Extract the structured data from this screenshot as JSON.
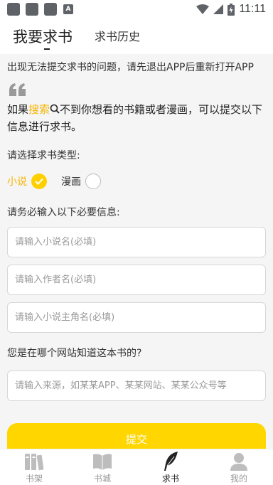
{
  "status_bar": {
    "time": "11:11",
    "icons": [
      "notification-square-icon",
      "notification-square-icon",
      "notification-square-icon",
      "a-icon",
      "wifi-icon",
      "signal-icon",
      "battery-icon"
    ]
  },
  "header": {
    "active_tab": "我要求书",
    "second_tab": "求书历史"
  },
  "notice": "出现无法提交求书的问题，请先退出APP后重新打开APP",
  "intro": {
    "prefix": "如果",
    "highlight": "搜索",
    "suffix": "不到你想看的书籍或者漫画，可以提交以下信息进行求书。"
  },
  "type_section": {
    "label": "请选择求书类型:",
    "options": [
      {
        "label": "小说",
        "selected": true
      },
      {
        "label": "漫画",
        "selected": false
      }
    ]
  },
  "required_section": {
    "label": "请务必输入以下必要信息:",
    "fields": [
      {
        "placeholder": "请输入小说名(必填)",
        "value": ""
      },
      {
        "placeholder": "请输入作者名(必填)",
        "value": ""
      },
      {
        "placeholder": "请输入小说主角名(必填)",
        "value": ""
      }
    ]
  },
  "source_section": {
    "label": "您是在哪个网站知道这本书的?",
    "placeholder": "请输入来源，如某某APP、某某网站、某某公众号等",
    "value": ""
  },
  "submit_label": "提交",
  "bottom_nav": [
    {
      "label": "书架",
      "icon": "bookshelf-icon",
      "active": false
    },
    {
      "label": "书城",
      "icon": "open-book-icon",
      "active": false
    },
    {
      "label": "求书",
      "icon": "feather-quill-icon",
      "active": true
    },
    {
      "label": "我的",
      "icon": "user-icon",
      "active": false
    }
  ],
  "colors": {
    "accent": "#ffd600",
    "highlight_text": "#f6b400",
    "background": "#f5f5f5"
  }
}
